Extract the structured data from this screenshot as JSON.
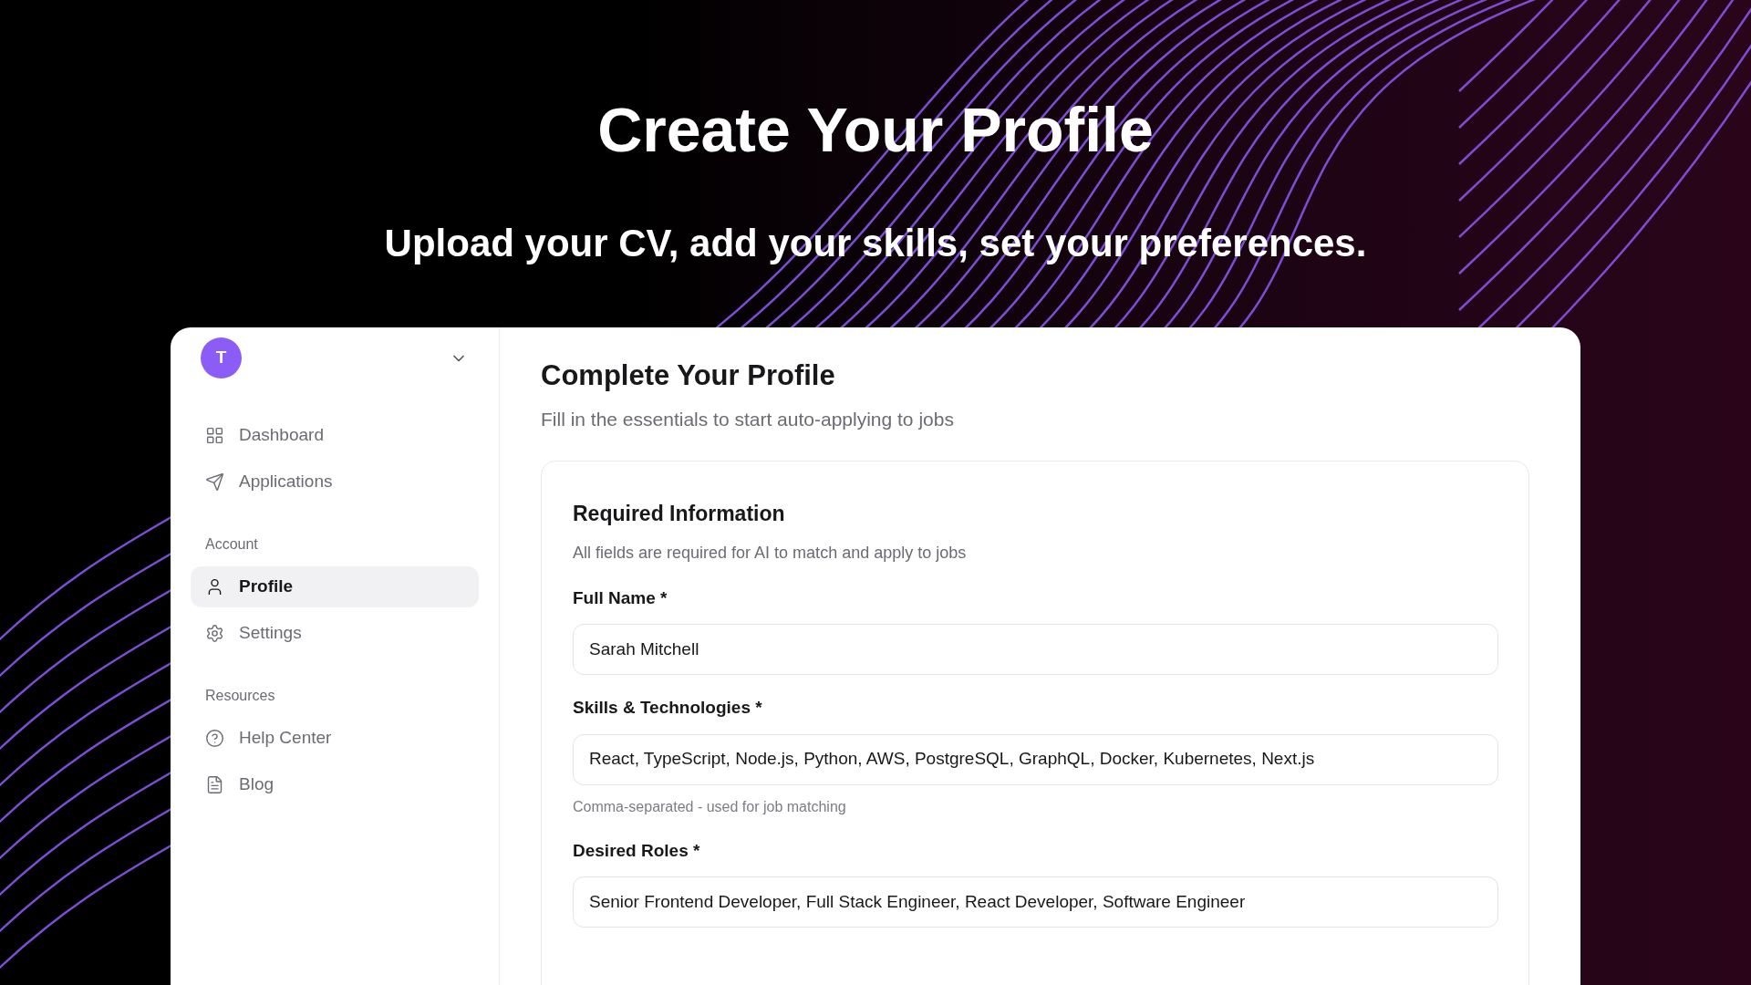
{
  "hero": {
    "title": "Create Your Profile",
    "subtitle": "Upload your CV, add your skills, set your preferences."
  },
  "sidebar": {
    "avatar": "T",
    "nav": [
      {
        "label": "Dashboard",
        "selected": false
      },
      {
        "label": "Applications",
        "selected": false
      }
    ],
    "sections": [
      {
        "heading": "Account",
        "items": [
          {
            "label": "Profile",
            "selected": true
          },
          {
            "label": "Settings",
            "selected": false
          }
        ]
      },
      {
        "heading": "Resources",
        "items": [
          {
            "label": "Help Center",
            "selected": false
          },
          {
            "label": "Blog",
            "selected": false
          }
        ]
      }
    ]
  },
  "main": {
    "title": "Complete Your Profile",
    "subtitle": "Fill in the essentials to start auto-applying to jobs",
    "card": {
      "title": "Required Information",
      "description": "All fields are required for AI to match and apply to jobs",
      "fields": [
        {
          "label": "Full Name *",
          "value": "Sarah Mitchell"
        },
        {
          "label": "Skills & Technologies *",
          "value": "React, TypeScript, Node.js, Python, AWS, PostgreSQL, GraphQL, Docker, Kubernetes, Next.js",
          "hint": "Comma-separated - used for job matching"
        },
        {
          "label": "Desired Roles *",
          "value": "Senior Frontend Developer, Full Stack Engineer, React Developer, Software Engineer"
        }
      ]
    }
  }
}
